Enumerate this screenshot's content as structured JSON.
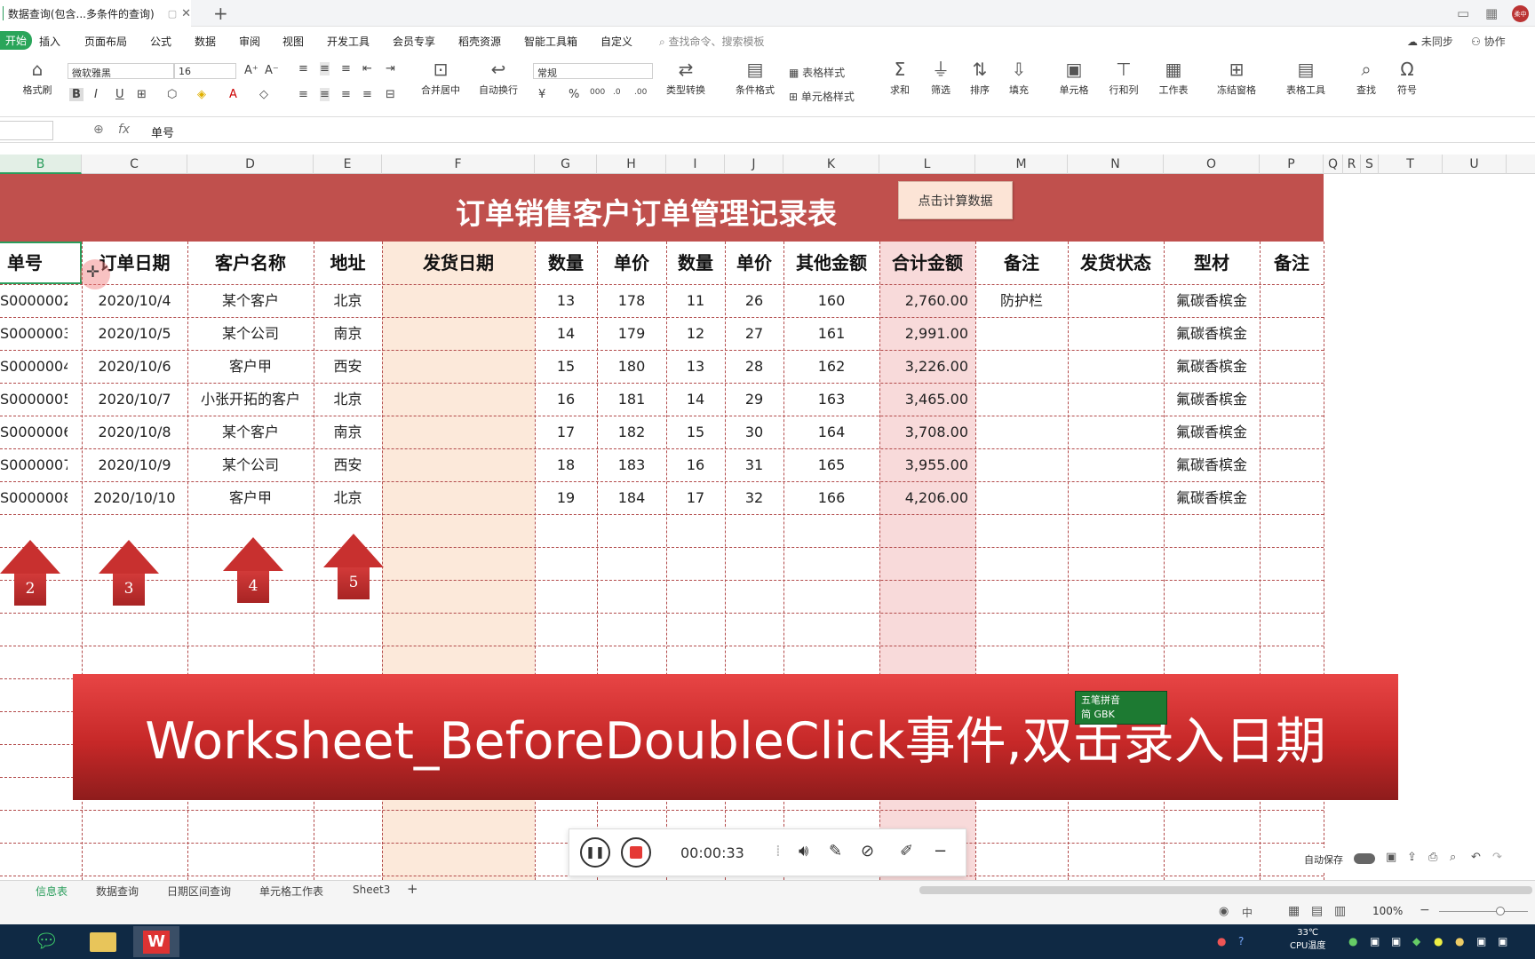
{
  "titlebar": {
    "doc_title": "数据查询(包含...多条件的查询)",
    "close": "✕",
    "new_tab": "+",
    "avatar": "柔中"
  },
  "menu": {
    "start": "开始",
    "items": [
      "插入",
      "页面布局",
      "公式",
      "数据",
      "审阅",
      "视图",
      "开发工具",
      "会员专享",
      "稻壳资源",
      "智能工具箱",
      "自定义"
    ],
    "search": "查找命令、搜索模板",
    "sync": "未同步",
    "collab": "协作"
  },
  "toolbar": {
    "format_brush": "格式刷",
    "font_name": "微软雅黑",
    "font_size": "16",
    "merge_center": "合并居中",
    "auto_wrap": "自动换行",
    "number_format": "常规",
    "type_convert": "类型转换",
    "cond_format": "条件格式",
    "table_style": "表格样式",
    "cell_style": "单元格样式",
    "sum": "求和",
    "filter": "筛选",
    "sort": "排序",
    "fill": "填充",
    "cell": "单元格",
    "row_col": "行和列",
    "worksheet": "工作表",
    "freeze": "冻结窗格",
    "table_tools": "表格工具",
    "find": "查找",
    "symbol": "符号",
    "bold": "B",
    "italic": "I",
    "underline": "U"
  },
  "formula_bar": {
    "fx": "fx",
    "content": "单号"
  },
  "columns": [
    "B",
    "C",
    "D",
    "E",
    "F",
    "G",
    "H",
    "I",
    "J",
    "K",
    "L",
    "M",
    "N",
    "O",
    "P",
    "Q",
    "R",
    "S",
    "T",
    "U"
  ],
  "sheet": {
    "title": "订单销售客户订单管理记录表",
    "calc_button": "点击计算数据",
    "headers": [
      "单号",
      "订单日期",
      "客户名称",
      "地址",
      "发货日期",
      "数量",
      "单价",
      "数量",
      "单价",
      "其他金额",
      "合计金额",
      "备注",
      "发货状态",
      "型材",
      "备注"
    ],
    "rows": [
      [
        "S0000002",
        "2020/10/4",
        "某个客户",
        "北京",
        "",
        "13",
        "178",
        "11",
        "26",
        "160",
        "2,760.00",
        "防护栏",
        "",
        "氟碳香槟金",
        ""
      ],
      [
        "S0000003",
        "2020/10/5",
        "某个公司",
        "南京",
        "",
        "14",
        "179",
        "12",
        "27",
        "161",
        "2,991.00",
        "",
        "",
        "氟碳香槟金",
        ""
      ],
      [
        "S0000004",
        "2020/10/6",
        "客户甲",
        "西安",
        "",
        "15",
        "180",
        "13",
        "28",
        "162",
        "3,226.00",
        "",
        "",
        "氟碳香槟金",
        ""
      ],
      [
        "S0000005",
        "2020/10/7",
        "小张开拓的客户",
        "北京",
        "",
        "16",
        "181",
        "14",
        "29",
        "163",
        "3,465.00",
        "",
        "",
        "氟碳香槟金",
        ""
      ],
      [
        "S0000006",
        "2020/10/8",
        "某个客户",
        "南京",
        "",
        "17",
        "182",
        "15",
        "30",
        "164",
        "3,708.00",
        "",
        "",
        "氟碳香槟金",
        ""
      ],
      [
        "S0000007",
        "2020/10/9",
        "某个公司",
        "西安",
        "",
        "18",
        "183",
        "16",
        "31",
        "165",
        "3,955.00",
        "",
        "",
        "氟碳香槟金",
        ""
      ],
      [
        "S0000008",
        "2020/10/10",
        "客户甲",
        "北京",
        "",
        "19",
        "184",
        "17",
        "32",
        "166",
        "4,206.00",
        "",
        "",
        "氟碳香槟金",
        ""
      ]
    ],
    "arrows": [
      "2",
      "3",
      "4",
      "5"
    ]
  },
  "banner": {
    "text": "Worksheet_BeforeDoubleClick事件,双击录入日期"
  },
  "ime": {
    "line1": "五笔拼音",
    "line2": "简 GBK"
  },
  "recorder": {
    "time": "00:00:33"
  },
  "autosave": {
    "label": "自动保存"
  },
  "sheet_tabs": [
    "信息表",
    "数据查询",
    "日期区间查询",
    "单元格工作表",
    "Sheet3"
  ],
  "status": {
    "input_mode": "中",
    "zoom": "100%"
  },
  "taskbar": {
    "temp": "33℃",
    "cpu": "CPU温度"
  },
  "colors": {
    "title_band": "#c0504d",
    "accent": "#2a9d5c",
    "banner": "#c62828",
    "shade_f": "#fce9da",
    "shade_l": "#f8dada"
  }
}
